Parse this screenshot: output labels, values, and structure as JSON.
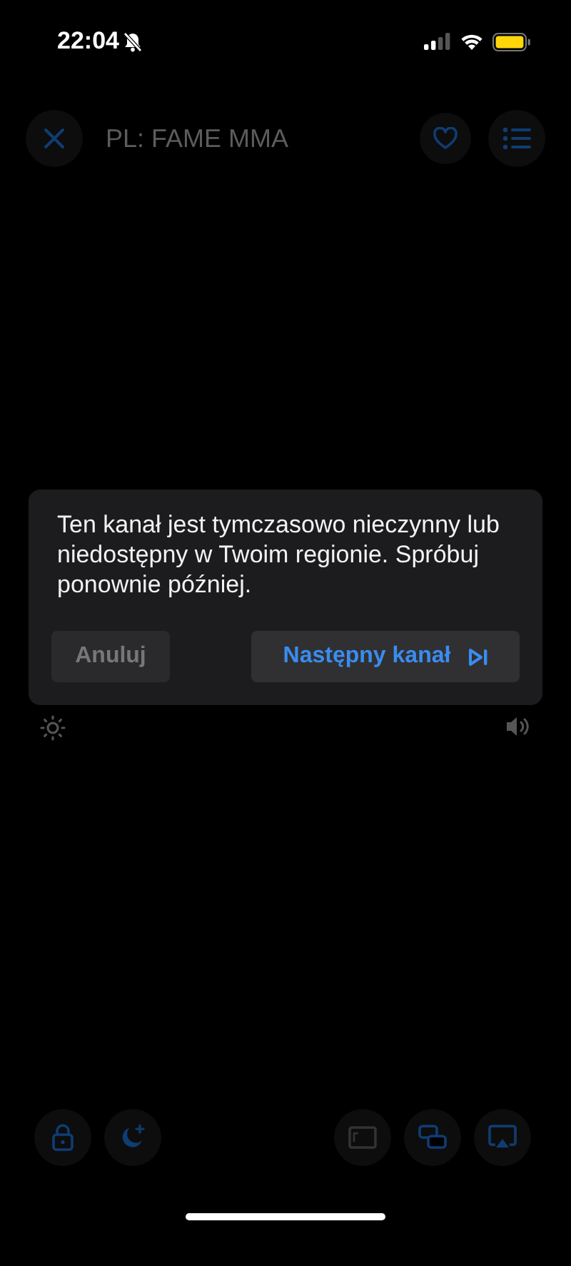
{
  "status_bar": {
    "time": "22:04"
  },
  "top_bar": {
    "title": "PL: FAME MMA"
  },
  "dialog": {
    "message": "Ten kanał jest tymczasowo nieczynny lub niedostępny w Twoim regionie. Spróbuj ponownie później.",
    "cancel_button": {
      "label": "Anuluj",
      "disabled": true
    },
    "next_button": {
      "label": "Następny kanał",
      "disabled": false
    }
  }
}
